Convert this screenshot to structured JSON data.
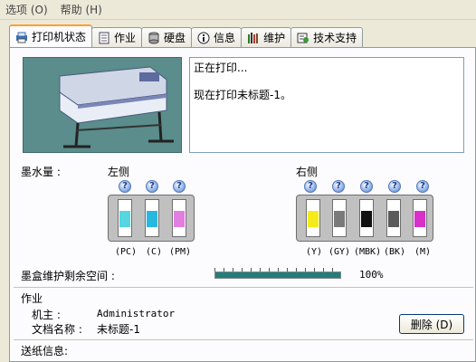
{
  "menubar": {
    "items": [
      {
        "label": "选项 (O)",
        "disabled": false
      },
      {
        "label": "帮助 (H)",
        "disabled": false
      }
    ]
  },
  "tabs": [
    {
      "label": "打印机状态",
      "icon": "printer-icon",
      "active": true
    },
    {
      "label": "作业",
      "icon": "document-icon",
      "active": false
    },
    {
      "label": "硬盘",
      "icon": "harddisk-icon",
      "active": false
    },
    {
      "label": "信息",
      "icon": "info-icon",
      "active": false
    },
    {
      "label": "维护",
      "icon": "maintenance-icon",
      "active": false
    },
    {
      "label": "技术支持",
      "icon": "support-icon",
      "active": false
    }
  ],
  "status": {
    "line1": "正在打印...",
    "line2": "现在打印未标题-1。"
  },
  "ink": {
    "title": "墨水量 :",
    "left_label": "左侧",
    "right_label": "右侧",
    "help_glyph": "?",
    "left": [
      {
        "code": "(PC)",
        "color": "#55d6e0"
      },
      {
        "code": "(C)",
        "color": "#27b8e0"
      },
      {
        "code": "(PM)",
        "color": "#e27ee0"
      }
    ],
    "right": [
      {
        "code": "(Y)",
        "color": "#f4ec1a"
      },
      {
        "code": "(GY)",
        "color": "#7a7a7a"
      },
      {
        "code": "(MBK)",
        "color": "#111111"
      },
      {
        "code": "(BK)",
        "color": "#5a5a5a"
      },
      {
        "code": "(M)",
        "color": "#d830c8"
      }
    ]
  },
  "maintenance": {
    "label": "墨盒维护剩余空间 :",
    "value_text": "100%",
    "fill_fraction": 1.0,
    "fill_color": "#267b7b"
  },
  "job": {
    "section_title": "作业",
    "owner_label": "机主 :",
    "owner_value": "Administrator",
    "docname_label": "文档名称 :",
    "docname_value": "未标题-1",
    "delete_button": "删除 (D)"
  },
  "feed": {
    "section_title": "送纸信息:"
  }
}
